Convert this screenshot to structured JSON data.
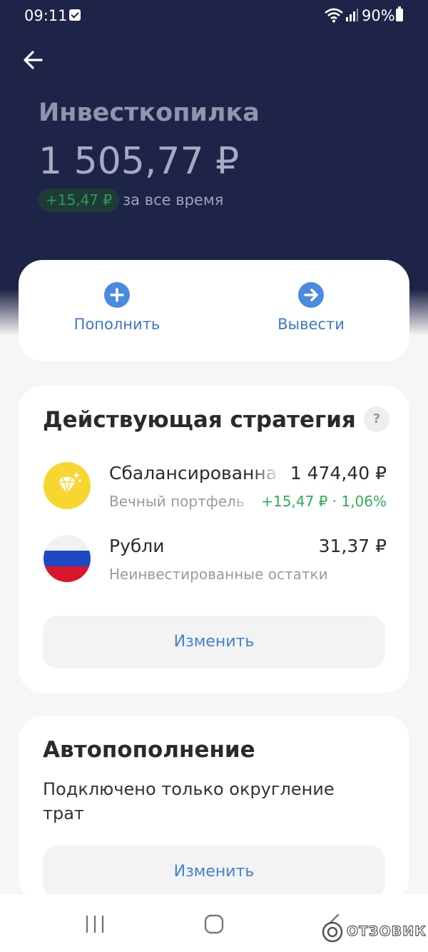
{
  "status_bar": {
    "time": "09:11",
    "battery": "90%"
  },
  "header": {
    "title": "Инвесткопилка",
    "balance": "1 505,77 ₽",
    "gain": "+15,47 ₽",
    "gain_period": "за все время"
  },
  "actions": {
    "topup_label": "Пополнить",
    "withdraw_label": "Вывести"
  },
  "strategy": {
    "title": "Действующая стратегия",
    "help": "?",
    "assets": [
      {
        "name": "Сбалансированная",
        "subtitle": "Вечный портфель",
        "value": "1 474,40 ₽",
        "change": "+15,47 ₽ · 1,06%",
        "icon": "diamond-icon"
      },
      {
        "name": "Рубли",
        "subtitle": "Неинвестированные остатки",
        "value": "31,37 ₽",
        "icon": "russia-flag-icon"
      }
    ],
    "change_label": "Изменить"
  },
  "autofill": {
    "title": "Автопополнение",
    "description": "Подключено только округление трат",
    "change_label": "Изменить"
  },
  "watermark": {
    "text": "ОТЗОВИК"
  },
  "colors": {
    "header_bg": "#1e2447",
    "accent_blue": "#3d77c8",
    "positive_green": "#2fae55",
    "diamond_yellow": "#f7d72f"
  }
}
